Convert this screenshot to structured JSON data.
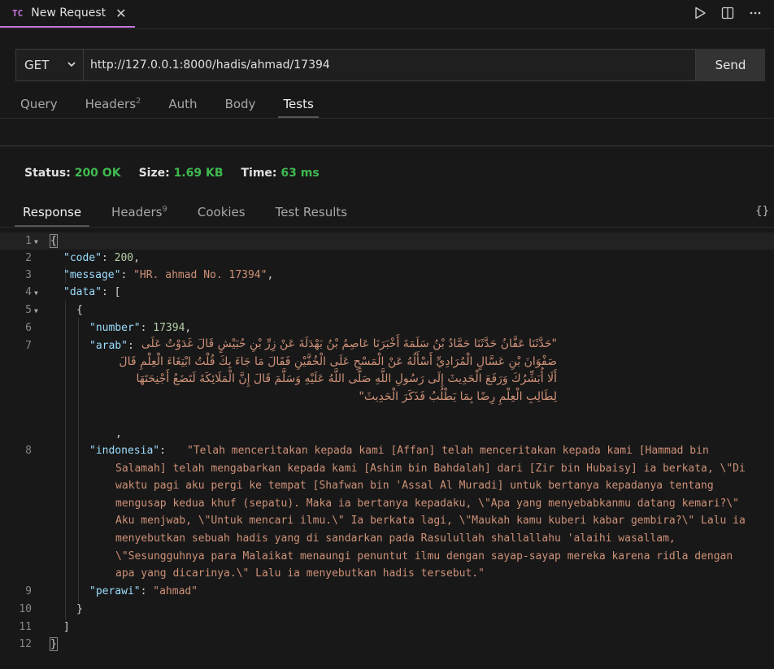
{
  "tab": {
    "logo": "TC",
    "title": "New Request",
    "close_glyph": "✕"
  },
  "request": {
    "method": "GET",
    "url": "http://127.0.0.1:8000/hadis/ahmad/17394",
    "send_label": "Send"
  },
  "request_tabs": [
    {
      "label": "Query"
    },
    {
      "label": "Headers",
      "badge": "2"
    },
    {
      "label": "Auth"
    },
    {
      "label": "Body"
    },
    {
      "label": "Tests",
      "active": true
    }
  ],
  "status": {
    "status_label": "Status:",
    "status_value": "200 OK",
    "size_label": "Size:",
    "size_value": "1.69 KB",
    "time_label": "Time:",
    "time_value": "63 ms"
  },
  "response_tabs": [
    {
      "label": "Response",
      "active": true
    },
    {
      "label": "Headers",
      "badge": "9"
    },
    {
      "label": "Cookies"
    },
    {
      "label": "Test Results"
    }
  ],
  "braces_glyph": "{}",
  "json": {
    "code_key": "\"code\"",
    "code_value": "200",
    "message_key": "\"message\"",
    "message_value": "\"HR. ahmad No. 17394\"",
    "data_key": "\"data\"",
    "number_key": "\"number\"",
    "number_value": "17394",
    "arab_key": "\"arab\"",
    "arab_value": "\"حَدَّثَنَا عَفَّانُ حَدَّثَنَا حَمَّادُ بْنُ سَلَمَةَ أَخْبَرَنَا عَاصِمُ بْنُ بَهْدَلَةَ عَنْ زِرِّ بْنِ حُبَيْشٍ قَالَ غَدَوْتُ عَلَى صَفْوَانَ بْنِ عَسَّالٍ الْمُرَادِيِّ أَسْأَلُهُ عَنْ الْمَسْحِ عَلَى الْخُفَّيْنِ فَقَالَ مَا جَاءَ بِكَ قُلْتُ ابْتِغَاءَ الْعِلْمِ قَالَ أَلَا أُبَشِّرُكَ وَرَفَعَ الْحَدِيثَ إِلَى رَسُولِ اللَّهِ صَلَّى اللَّهُ عَلَيْهِ وَسَلَّمَ قَالَ إِنَّ الْمَلَائِكَةَ لَتَضَعُ أَجْنِحَتَهَا لِطَالِبِ الْعِلْمِ رِضًا بِمَا يَطْلُبُ فَذَكَرَ الْحَدِيثَ\"",
    "indonesia_key": "\"indonesia\"",
    "indonesia_value": "\"Telah menceritakan kepada kami [Affan] telah menceritakan kepada kami [Hammad bin Salamah] telah mengabarkan kepada kami [Ashim bin Bahdalah] dari [Zir bin Hubaisy] ia berkata, \\\"Di waktu pagi aku pergi ke tempat [Shafwan bin 'Assal Al Muradi] untuk bertanya kepadanya tentang mengusap kedua khuf (sepatu). Maka ia bertanya kepadaku, \\\"Apa yang menyebabkanmu datang kemari?\\\" Aku menjwab, \\\"Untuk mencari ilmu.\\\" Ia berkata lagi, \\\"Maukah kamu kuberi kabar gembira?\\\" Lalu ia menyebutkan sebuah hadis yang di sandarkan pada Rasulullah shallallahu 'alaihi wasallam, \\\"Sesungguhnya para Malaikat menaungi penuntut ilmu dengan sayap-sayap mereka karena ridla dengan apa yang dicarinya.\\\" Lalu ia menyebutkan hadis tersebut.\"",
    "perawi_key": "\"perawi\"",
    "perawi_value": "\"ahmad\""
  },
  "line_numbers": [
    "1",
    "2",
    "3",
    "4",
    "5",
    "6",
    "7",
    "8",
    "9",
    "10",
    "11",
    "12"
  ],
  "colors": {
    "accent": "#c678dd",
    "status_green": "#3fb950",
    "json_key": "#9cdcfe",
    "json_string": "#ce9178",
    "json_number": "#b5cea8"
  }
}
